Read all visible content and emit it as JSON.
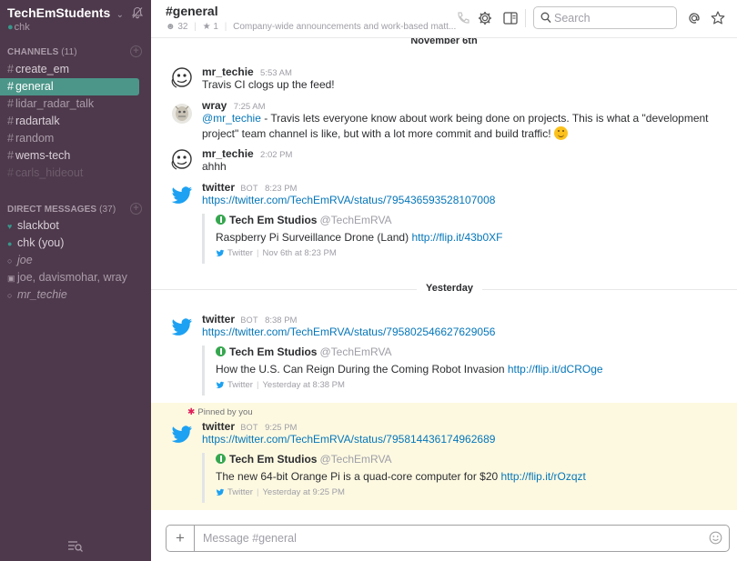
{
  "team": {
    "name": "TechEmStudents",
    "chevron": "⌄",
    "user": "chk",
    "bell_icon": "bell-off-icon"
  },
  "channels": {
    "header": "CHANNELS",
    "count": "(11)",
    "items": [
      {
        "name": "create_em",
        "state": "normal"
      },
      {
        "name": "general",
        "state": "active"
      },
      {
        "name": "lidar_radar_talk",
        "state": "normal"
      },
      {
        "name": "radartalk",
        "state": "normal"
      },
      {
        "name": "random",
        "state": "normal"
      },
      {
        "name": "wems-tech",
        "state": "normal"
      },
      {
        "name": "carls_hideout",
        "state": "muted"
      }
    ]
  },
  "dms": {
    "header": "DIRECT MESSAGES",
    "count": "(37)",
    "items": [
      {
        "name": "slackbot",
        "icon": "heart-icon"
      },
      {
        "name": "chk (you)",
        "icon": "online-dot-icon"
      },
      {
        "name": "joe",
        "icon": "offline-dot-icon"
      },
      {
        "name": "joe, davismohar, wray",
        "icon": "group-icon"
      },
      {
        "name": "mr_techie",
        "icon": "offline-dot-icon"
      }
    ]
  },
  "header": {
    "channel": "#general",
    "members": "32",
    "pinned": "1",
    "topic": "Company-wide announcements and work-based matt...",
    "search_placeholder": "Search"
  },
  "messages": {
    "day_top": "November 6th",
    "day_yesterday": "Yesterday",
    "m1": {
      "author": "mr_techie",
      "time": "5:53 AM",
      "text": "Travis CI clogs up the feed!"
    },
    "m2": {
      "author": "wray",
      "time": "7:25 AM",
      "mention": "@mr_techie",
      "text": " - Travis lets everyone know about work being done on projects. This is what a \"development project\" team channel is like, but with a lot more commit and build traffic! "
    },
    "m3": {
      "author": "mr_techie",
      "time": "2:02 PM",
      "text": "ahhh"
    },
    "m4": {
      "author": "twitter",
      "bot": "BOT",
      "time": "8:23 PM",
      "link": "https://twitter.com/TechEmRVA/status/795436593528107008",
      "att_name": "Tech Em Studios",
      "att_handle": "@TechEmRVA",
      "att_text": "Raspberry Pi Surveillance Drone (Land) ",
      "att_link": "http://flip.it/43b0XF",
      "att_source": "Twitter",
      "att_time": "Nov 6th at 8:23 PM"
    },
    "m5": {
      "author": "twitter",
      "bot": "BOT",
      "time": "8:38 PM",
      "link": "https://twitter.com/TechEmRVA/status/795802546627629056",
      "att_name": "Tech Em Studios",
      "att_handle": "@TechEmRVA",
      "att_text": "How the U.S. Can Reign During the Coming Robot Invasion ",
      "att_link": "http://flip.it/dCROge",
      "att_source": "Twitter",
      "att_time": "Yesterday at 8:38 PM"
    },
    "m6": {
      "pinned_note": "Pinned by you",
      "author": "twitter",
      "bot": "BOT",
      "time": "9:25 PM",
      "link": "https://twitter.com/TechEmRVA/status/795814436174962689",
      "att_name": "Tech Em Studios",
      "att_handle": "@TechEmRVA",
      "att_text": "The new 64-bit Orange Pi is a quad-core computer for $20 ",
      "att_link": "http://flip.it/rOzqzt",
      "att_source": "Twitter",
      "att_time": "Yesterday at 9:25 PM"
    }
  },
  "composer": {
    "placeholder": "Message #general",
    "plus": "+"
  },
  "colors": {
    "sidebar": "#4d394b",
    "active": "#4c9689",
    "link": "#0576b9",
    "twitter": "#1da1f2",
    "pinned_bg": "#fdf9e1"
  }
}
